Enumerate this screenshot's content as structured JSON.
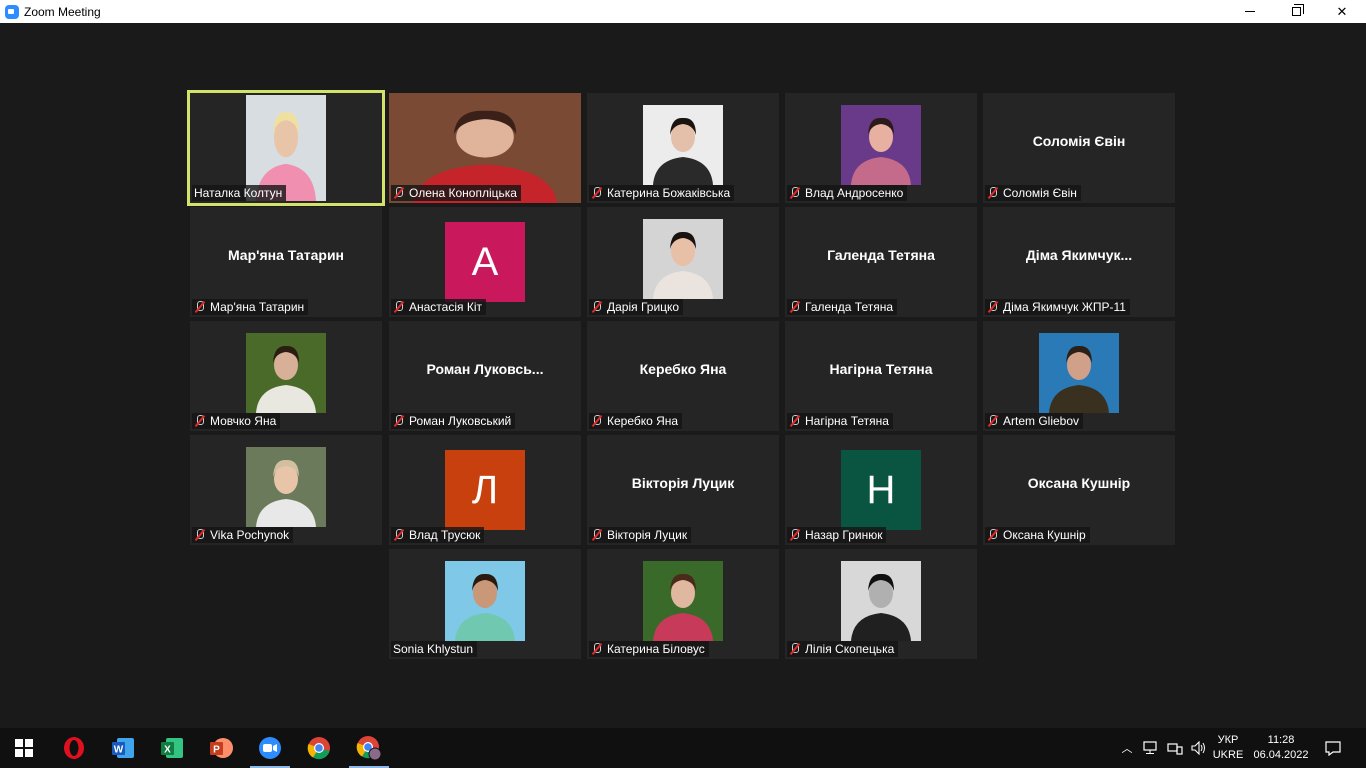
{
  "window": {
    "title": "Zoom Meeting"
  },
  "participants": [
    {
      "name": "Наталка Колтун",
      "tile_name": "",
      "avatar_letter": "",
      "avatar_color": "",
      "video": "person-pink",
      "muted": false,
      "active": true
    },
    {
      "name": "Олена Коноплiцька",
      "tile_name": "",
      "avatar_letter": "",
      "avatar_color": "",
      "video": "room-wide",
      "muted": true,
      "active": false
    },
    {
      "name": "Катерина Божакiвська",
      "tile_name": "",
      "avatar_letter": "",
      "avatar_color": "",
      "video": "portrait-dark",
      "muted": true,
      "active": false
    },
    {
      "name": "Влад Андросенко",
      "tile_name": "",
      "avatar_letter": "",
      "avatar_color": "",
      "video": "portrait-purple",
      "muted": true,
      "active": false
    },
    {
      "name": "Соломiя Євiн",
      "tile_name": "Соломiя Євiн",
      "avatar_letter": "",
      "avatar_color": "",
      "video": "",
      "muted": true,
      "active": false
    },
    {
      "name": "Мар'яна Татарин",
      "tile_name": "Мар'яна Татарин",
      "avatar_letter": "",
      "avatar_color": "",
      "video": "",
      "muted": true,
      "active": false
    },
    {
      "name": "Анастасiя Кiт",
      "tile_name": "",
      "avatar_letter": "A",
      "avatar_color": "#c9185b",
      "video": "",
      "muted": true,
      "active": false
    },
    {
      "name": "Дарiя Грицко",
      "tile_name": "",
      "avatar_letter": "",
      "avatar_color": "",
      "video": "portrait-light",
      "muted": true,
      "active": false
    },
    {
      "name": "Галенда Тетяна",
      "tile_name": "Галенда Тетяна",
      "avatar_letter": "",
      "avatar_color": "",
      "video": "",
      "muted": true,
      "active": false
    },
    {
      "name": "Дiма Якимчук ЖПР-11",
      "tile_name": "Дiма  Якимчук...",
      "avatar_letter": "",
      "avatar_color": "",
      "video": "",
      "muted": true,
      "active": false
    },
    {
      "name": "Мовчко Яна",
      "tile_name": "",
      "avatar_letter": "",
      "avatar_color": "",
      "video": "portrait-garden",
      "muted": true,
      "active": false
    },
    {
      "name": "Роман Луковський",
      "tile_name": "Роман  Луковсь...",
      "avatar_letter": "",
      "avatar_color": "",
      "video": "",
      "muted": true,
      "active": false
    },
    {
      "name": "Керебко Яна",
      "tile_name": "Керебко Яна",
      "avatar_letter": "",
      "avatar_color": "",
      "video": "",
      "muted": true,
      "active": false
    },
    {
      "name": "Нагiрна Тетяна",
      "tile_name": "Нагiрна Тетяна",
      "avatar_letter": "",
      "avatar_color": "",
      "video": "",
      "muted": true,
      "active": false
    },
    {
      "name": "Artem Gliebov",
      "tile_name": "",
      "avatar_letter": "",
      "avatar_color": "",
      "video": "portrait-sky",
      "muted": true,
      "active": false
    },
    {
      "name": "Vika Pochynok",
      "tile_name": "",
      "avatar_letter": "",
      "avatar_color": "",
      "video": "portrait-outdoor",
      "muted": true,
      "active": false
    },
    {
      "name": "Влад Трусюк",
      "tile_name": "",
      "avatar_letter": "Л",
      "avatar_color": "#c9400f",
      "video": "",
      "muted": true,
      "active": false
    },
    {
      "name": "Вiкторiя Луцик",
      "tile_name": "Вiкторiя Луцик",
      "avatar_letter": "",
      "avatar_color": "",
      "video": "",
      "muted": true,
      "active": false
    },
    {
      "name": "Назар Гринюк",
      "tile_name": "",
      "avatar_letter": "Н",
      "avatar_color": "#0a5541",
      "video": "",
      "muted": true,
      "active": false
    },
    {
      "name": "Оксана Кушнiр",
      "tile_name": "Оксана Кушнiр",
      "avatar_letter": "",
      "avatar_color": "",
      "video": "",
      "muted": true,
      "active": false
    },
    {
      "name": "Sonia Khlystun",
      "tile_name": "",
      "avatar_letter": "",
      "avatar_color": "",
      "video": "portrait-beach",
      "muted": false,
      "active": false
    },
    {
      "name": "Катерина Бiловус",
      "tile_name": "",
      "avatar_letter": "",
      "avatar_color": "",
      "video": "portrait-flowers",
      "muted": true,
      "active": false
    },
    {
      "name": "Лiлiя Скопецька",
      "tile_name": "",
      "avatar_letter": "",
      "avatar_color": "",
      "video": "portrait-bw",
      "muted": true,
      "active": false
    }
  ],
  "taskbar": {
    "apps": [
      "windows-start",
      "opera",
      "word",
      "excel",
      "powerpoint",
      "zoom",
      "chrome",
      "chrome-profile"
    ],
    "language": "УКР",
    "layout": "UKRE",
    "time": "11:28",
    "date": "06.04.2022"
  }
}
